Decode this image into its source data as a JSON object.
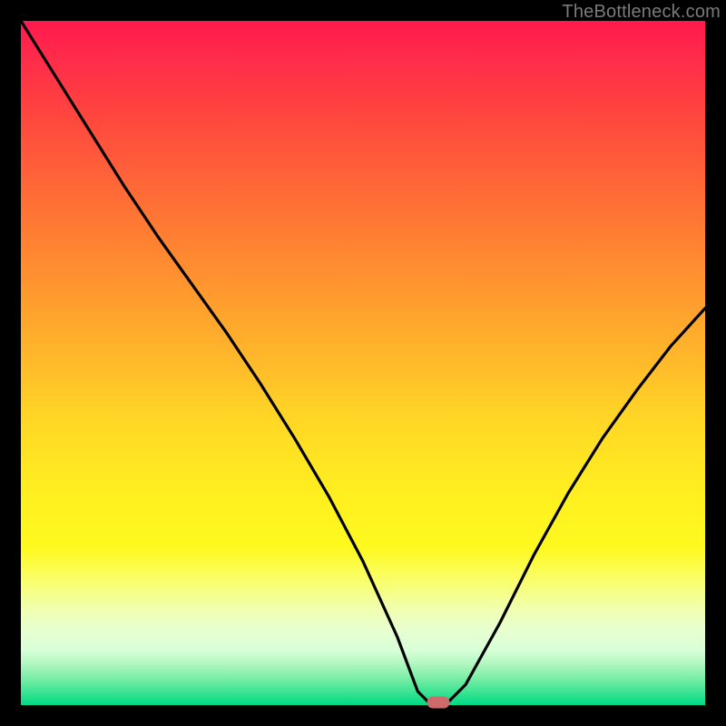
{
  "watermark": "TheBottleneck.com",
  "chart_data": {
    "type": "line",
    "title": "",
    "xlabel": "",
    "ylabel": "",
    "xlim": [
      0,
      100
    ],
    "ylim": [
      0,
      100
    ],
    "x": [
      0,
      5,
      10,
      15,
      20,
      25,
      30,
      35,
      40,
      45,
      50,
      55,
      58,
      60,
      62,
      65,
      70,
      75,
      80,
      85,
      90,
      95,
      100
    ],
    "y": [
      100,
      92,
      84,
      76,
      68.5,
      61.5,
      54.5,
      47,
      39,
      30.5,
      21,
      10,
      2,
      0,
      0,
      3,
      12,
      22,
      31,
      39,
      46,
      52.5,
      58
    ],
    "marker": {
      "x": 61,
      "y": 0
    },
    "background": "red-yellow-green-vertical-gradient"
  },
  "colors": {
    "curve": "#000000",
    "marker": "#cf6a6a",
    "frame": "#000000"
  }
}
